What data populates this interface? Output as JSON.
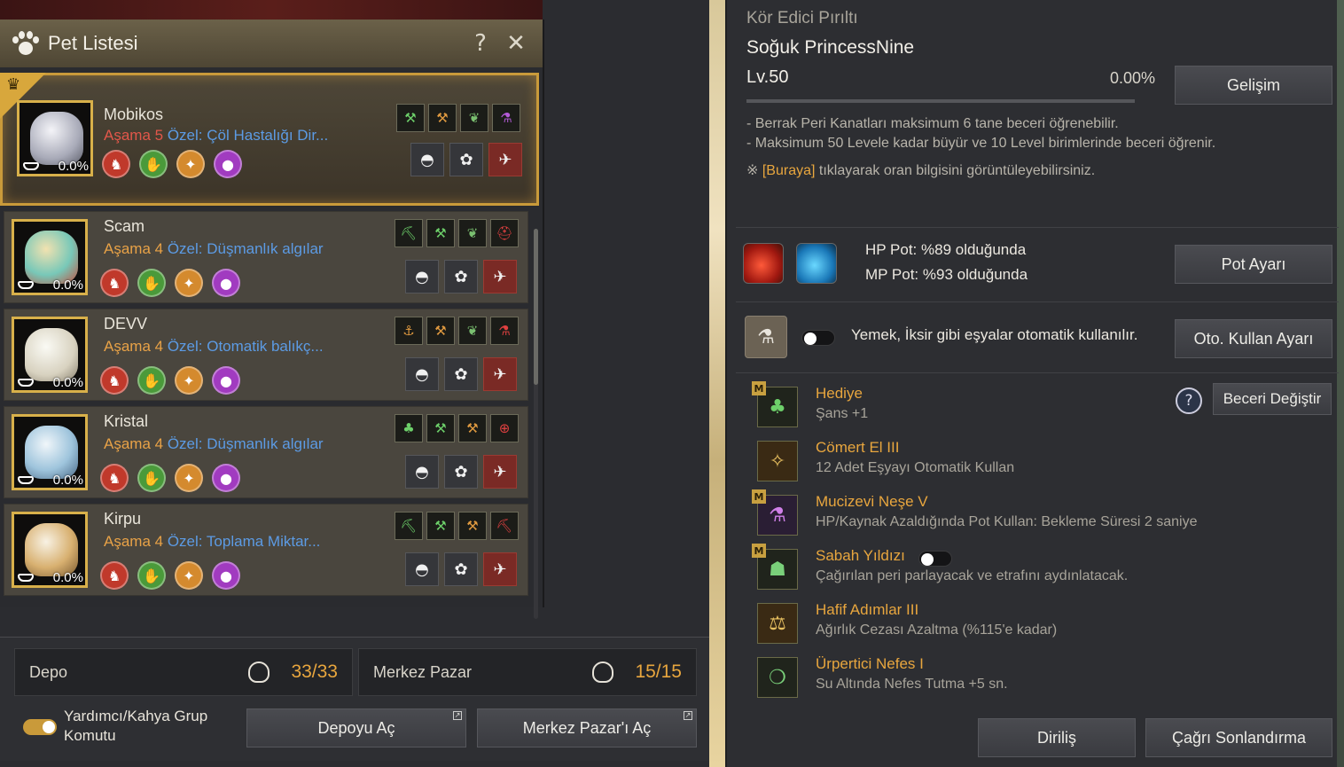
{
  "pet_list": {
    "title": "Pet Listesi",
    "help": "?",
    "close": "✕",
    "pets": [
      {
        "name": "Mobikos",
        "stage": "Aşama 5",
        "special": "Özel: Çöl Hastalığı Dir...",
        "percent": "0.0%",
        "stage_color": "#e2574a"
      },
      {
        "name": "Scam",
        "stage": "Aşama 4",
        "special": "Özel: Düşmanlık algılar",
        "percent": "0.0%",
        "stage_color": "#e8a247"
      },
      {
        "name": "DEVV",
        "stage": "Aşama 4",
        "special": "Özel: Otomatik balıkç...",
        "percent": "0.0%",
        "stage_color": "#e8a247"
      },
      {
        "name": "Kristal",
        "stage": "Aşama 4",
        "special": "Özel: Düşmanlık algılar",
        "percent": "0.0%",
        "stage_color": "#e8a247"
      },
      {
        "name": "Kirpu",
        "stage": "Aşama 4",
        "special": "Özel: Toplama Miktar...",
        "percent": "0.0%",
        "stage_color": "#e8a247"
      }
    ]
  },
  "storage": {
    "depo_label": "Depo",
    "depo_count": "33/33",
    "pazar_label": "Merkez Pazar",
    "pazar_count": "15/15",
    "toggle_label_1": "Yardımcı/Kahya Grup",
    "toggle_label_2": "Komutu",
    "toggle_on": true,
    "open_depo": "Depoyu Aç",
    "open_pazar": "Merkez Pazar'ı Aç"
  },
  "detail": {
    "prev_name": "Kör Edici Pırıltı",
    "name": "Soğuk PrincessNine",
    "level": "Lv.50",
    "xp_percent": "0.00%",
    "xp_fraction": 0.0,
    "evolve_button": "Gelişim",
    "info_1": "- Berrak Peri Kanatları maksimum 6 tane beceri öğrenebilir.",
    "info_2": "- Maksimum 50 Levele kadar büyür ve 10 Level birimlerinde beceri öğrenir.",
    "info_3_prefix": "※ ",
    "info_3_link": "[Buraya]",
    "info_3_suffix": " tıklayarak oran bilgisini görüntüleyebilirsiniz.",
    "hp_pot": "HP Pot: %89 olduğunda",
    "mp_pot": "MP Pot: %93 olduğunda",
    "pot_button": "Pot Ayarı",
    "auto_text": "Yemek, İksir gibi eşyalar otomatik kullanılır.",
    "auto_button": "Oto. Kullan Ayarı",
    "help": "?",
    "skill_change_button": "Beceri Değiştir",
    "skills": [
      {
        "name": "Hediye",
        "desc": "Şans +1",
        "badge": "M",
        "icon": "clover-icon"
      },
      {
        "name": "Cömert El III",
        "desc": "12 Adet Eşyayı Otomatik Kullan",
        "badge": "",
        "icon": "fairy-icon"
      },
      {
        "name": "Mucizevi Neşe V",
        "desc": "HP/Kaynak Azaldığında Pot Kullan: Bekleme Süresi 2 saniye",
        "badge": "M",
        "icon": "potion-icon"
      },
      {
        "name": "Sabah Yıldızı",
        "desc": "Çağırılan peri parlayacak ve etrafını aydınlatacak.",
        "badge": "M",
        "icon": "lantern-icon"
      },
      {
        "name": "Hafif Adımlar III",
        "desc": "Ağırlık Cezası Azaltma (%115'e kadar)",
        "badge": "",
        "icon": "weight-icon"
      },
      {
        "name": "Ürpertici Nefes I",
        "desc": "Su Altında Nefes Tutma +5 sn.",
        "badge": "",
        "icon": "bubble-icon"
      }
    ],
    "revive_button": "Diriliş",
    "end_summon_button": "Çağrı Sonlandırma"
  },
  "colors": {
    "accent": "#e8a63e",
    "special": "#5c9be4",
    "gold": "#c99a3a"
  }
}
